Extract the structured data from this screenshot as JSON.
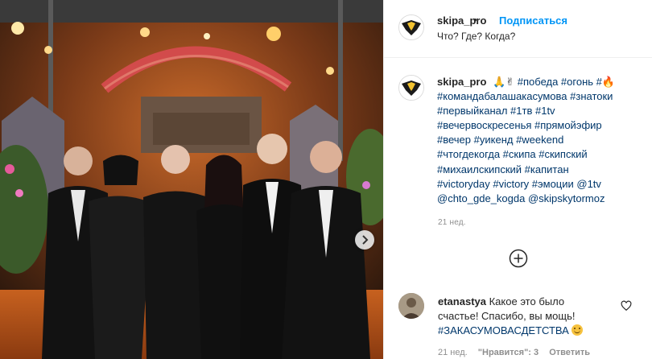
{
  "post": {
    "username": "skipa_pro",
    "separator": "•",
    "follow_label": "Подписаться",
    "subtitle": "Что? Где? Когда?"
  },
  "caption": {
    "username": "skipa_pro",
    "emoji_prefix": "🙏✌",
    "lines": [
      "#победа #огонь #🔥",
      "#командабалашакасумова #знатоки",
      "#первыйканал #1тв #1tv",
      "#вечервоскресенья #прямойэфир",
      "#вечер #уикенд #weekend",
      "#чтогдекогда #скипа #скипский",
      "#михаилскипский #капитан",
      "#victoryday #victory #эмоции @1tv",
      "@chto_gde_kogda @skipskytormoz"
    ],
    "time": "21 нед."
  },
  "comment": {
    "username": "etanastya",
    "text_line1": "Какое это было",
    "text_line2": "счастье! Спасибо, вы мощь!",
    "text_line3": "#ЗАКАСУМОВАСДЕТСТВА",
    "time": "21 нед.",
    "likes": "\"Нравится\": 3",
    "reply": "Ответить"
  },
  "icons": {
    "next": "chevron-right-icon",
    "add": "plus-circle-icon",
    "like": "heart-icon"
  },
  "colors": {
    "link": "#0095f6",
    "hashtag": "#00376b",
    "muted": "#8e8e8e"
  }
}
